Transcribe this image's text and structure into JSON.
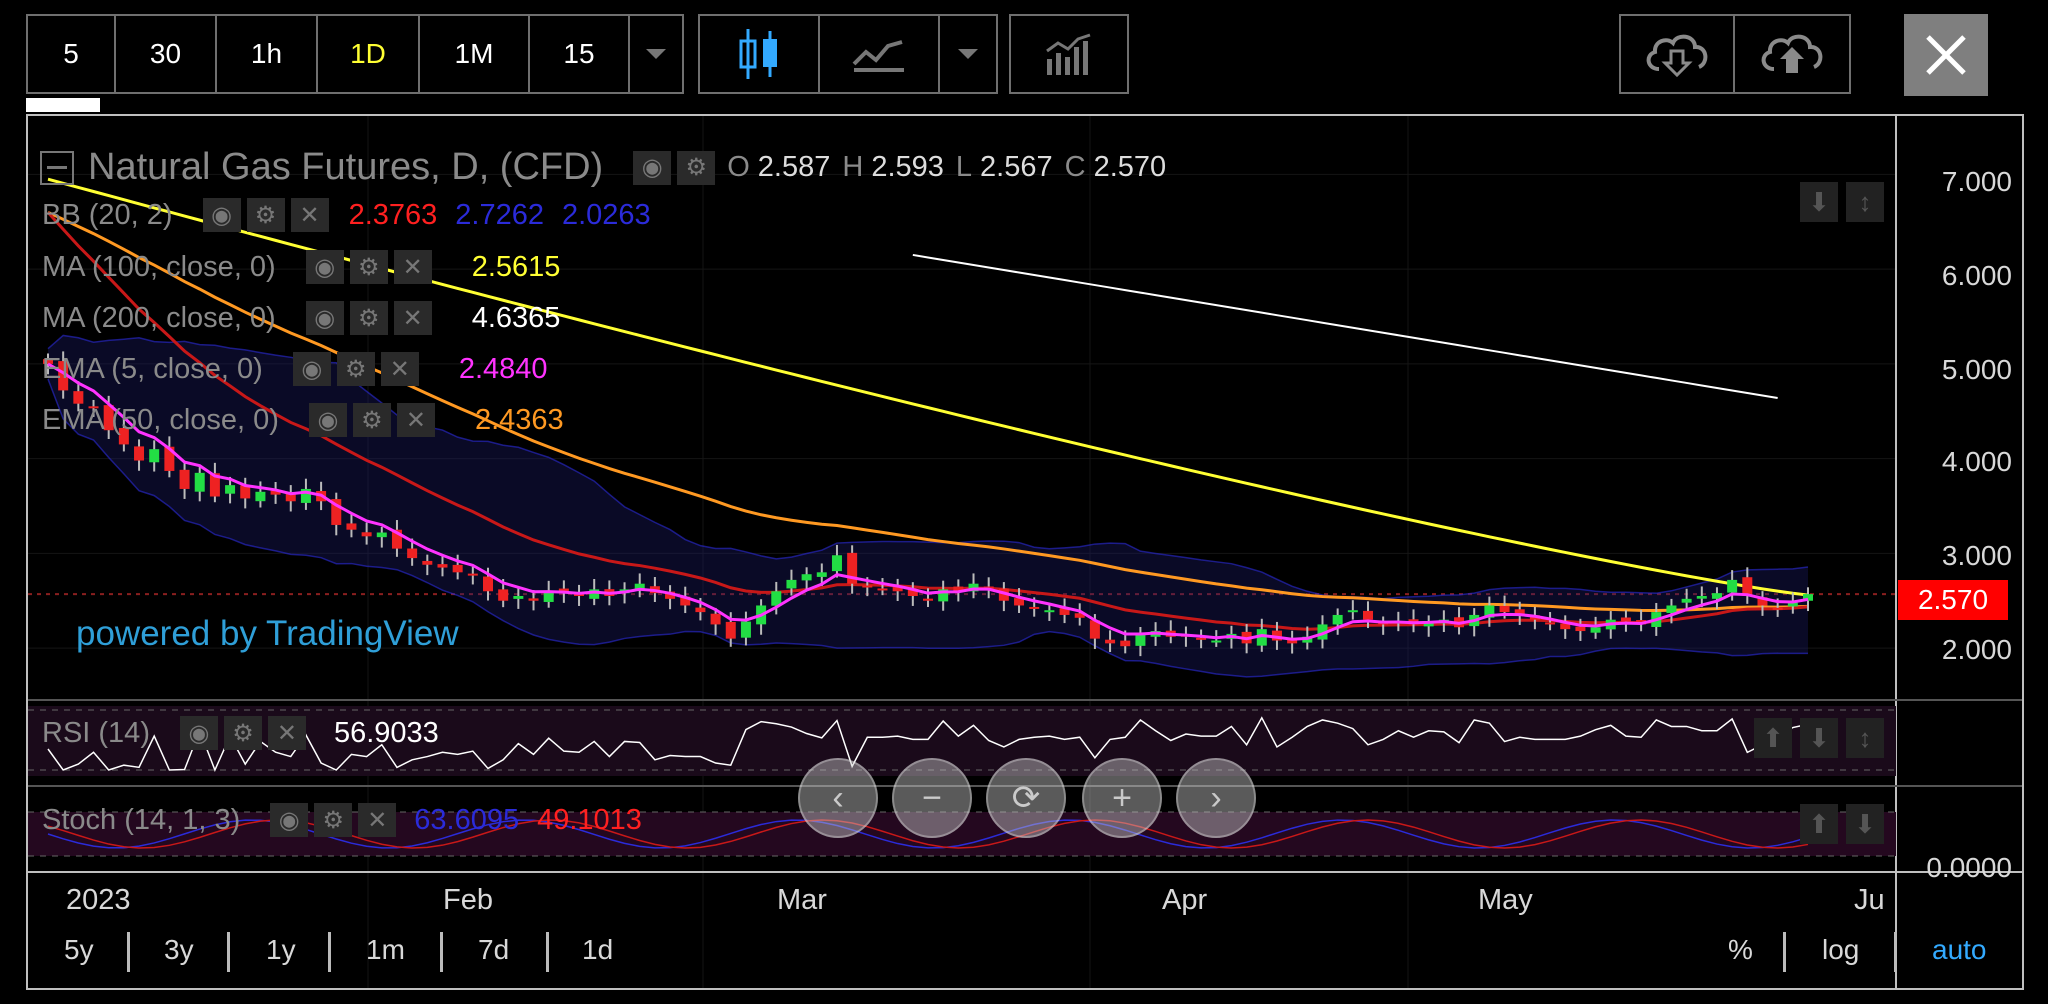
{
  "toolbar": {
    "intervals": [
      "5",
      "30",
      "1h",
      "1D",
      "1M",
      "15"
    ],
    "active_interval": "1D"
  },
  "legend": {
    "title": "Natural Gas Futures, D, (CFD)",
    "ohlc": {
      "o_label": "O",
      "o": "2.587",
      "h_label": "H",
      "h": "2.593",
      "l_label": "L",
      "l": "2.567",
      "c_label": "C",
      "c": "2.570"
    },
    "indicators": [
      {
        "name": "BB (20, 2)",
        "values": [
          {
            "v": "2.3763",
            "color": "#ff2020"
          },
          {
            "v": "2.7262",
            "color": "#2b2bd9"
          },
          {
            "v": "2.0263",
            "color": "#2b2bd9"
          }
        ]
      },
      {
        "name": "MA (100, close, 0)",
        "values": [
          {
            "v": "2.5615",
            "color": "#ffff33"
          }
        ]
      },
      {
        "name": "MA (200, close, 0)",
        "values": [
          {
            "v": "4.6365",
            "color": "#ffffff"
          }
        ]
      },
      {
        "name": "EMA (5, close, 0)",
        "values": [
          {
            "v": "2.4840",
            "color": "#ff33ff"
          }
        ]
      },
      {
        "name": "EMA (50, close, 0)",
        "values": [
          {
            "v": "2.4363",
            "color": "#ff9922"
          }
        ]
      }
    ],
    "rsi": {
      "name": "RSI (14)",
      "value": "56.9033"
    },
    "stoch": {
      "name": "Stoch (14, 1, 3)",
      "k": "63.6095",
      "d": "49.1013"
    }
  },
  "watermark": "powered by TradingView",
  "y_axis": {
    "labels": [
      "7.000",
      "6.000",
      "5.000",
      "4.000",
      "3.000",
      "2.000"
    ],
    "last_price": "2.570",
    "bottom_label": "0.0000"
  },
  "x_axis": {
    "labels": [
      "2023",
      "Feb",
      "Mar",
      "Apr",
      "May",
      "Ju"
    ]
  },
  "range_buttons": [
    "5y",
    "3y",
    "1y",
    "1m",
    "7d",
    "1d"
  ],
  "scale_options": {
    "percent": "%",
    "log": "log",
    "auto": "auto"
  },
  "colors": {
    "up": "#22dd44",
    "down": "#ee2222",
    "ma100": "#ffff33",
    "ma200": "#ffffff",
    "ema5": "#ff33ff",
    "ema50": "#ff9922",
    "bb_basis": "#ff2020",
    "bb_band": "#2b2bd9",
    "last_price_bg": "#ff0000",
    "auto_active": "#33aaff"
  },
  "chart_data": {
    "type": "candlestick",
    "ylim": [
      1.6,
      7.3
    ],
    "closes": [
      5.0,
      4.72,
      4.58,
      4.55,
      4.3,
      4.15,
      3.98,
      4.1,
      3.87,
      3.68,
      3.85,
      3.6,
      3.72,
      3.58,
      3.65,
      3.62,
      3.55,
      3.68,
      3.55,
      3.3,
      3.25,
      3.18,
      3.22,
      3.05,
      2.95,
      2.88,
      2.85,
      2.8,
      2.78,
      2.6,
      2.5,
      2.55,
      2.5,
      2.6,
      2.58,
      2.55,
      2.62,
      2.55,
      2.62,
      2.68,
      2.58,
      2.52,
      2.45,
      2.38,
      2.25,
      2.1,
      2.28,
      2.45,
      2.6,
      2.72,
      2.78,
      2.8,
      2.98,
      2.68,
      2.65,
      2.62,
      2.6,
      2.55,
      2.5,
      2.62,
      2.6,
      2.68,
      2.62,
      2.5,
      2.45,
      2.42,
      2.4,
      2.35,
      2.32,
      2.1,
      2.05,
      2.02,
      2.15,
      2.18,
      2.12,
      2.12,
      2.1,
      2.08,
      2.15,
      2.05,
      2.2,
      2.08,
      2.05,
      2.12,
      2.25,
      2.35,
      2.4,
      2.3,
      2.25,
      2.28,
      2.25,
      2.28,
      2.3,
      2.22,
      2.35,
      2.45,
      2.38,
      2.35,
      2.3,
      2.25,
      2.2,
      2.18,
      2.22,
      2.3,
      2.28,
      2.25,
      2.38,
      2.45,
      2.52,
      2.55,
      2.58,
      2.72,
      2.55,
      2.45,
      2.42,
      2.48,
      2.57
    ],
    "ma100_endpoints": [
      [
        0,
        6.95
      ],
      [
        114,
        2.56
      ]
    ],
    "ma200_endpoints": [
      [
        57,
        6.15
      ],
      [
        114,
        4.64
      ]
    ],
    "last": 2.57
  }
}
